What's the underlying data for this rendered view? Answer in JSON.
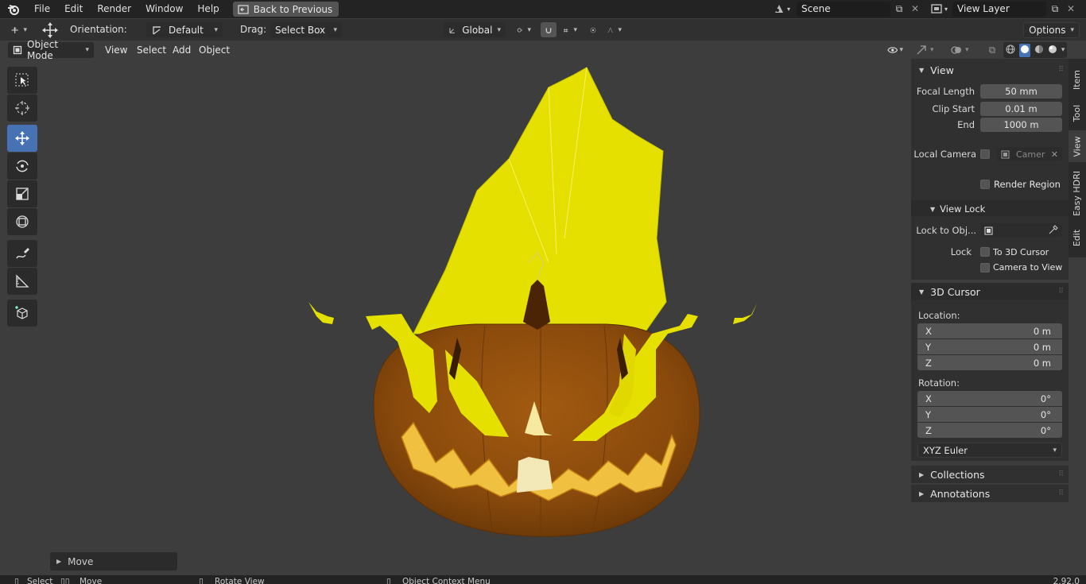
{
  "topbar": {
    "menus": [
      "File",
      "Edit",
      "Render",
      "Window",
      "Help"
    ],
    "back_button": "Back to Previous",
    "scene": "Scene",
    "view_layer": "View Layer"
  },
  "toolbar": {
    "orientation_label": "Orientation:",
    "orientation_value": "Default",
    "drag_label": "Drag:",
    "drag_value": "Select Box",
    "transform_orientation": "Global",
    "options": "Options"
  },
  "header": {
    "mode": "Object Mode",
    "menus": [
      "View",
      "Select",
      "Add",
      "Object"
    ]
  },
  "tools": [
    "select-box-icon",
    "cursor-icon",
    "move-icon",
    "rotate-icon",
    "scale-icon",
    "transform-icon",
    "annotate-icon",
    "measure-icon",
    "add-cube-icon"
  ],
  "operator_panel": {
    "label": "Move"
  },
  "npanel": {
    "view": {
      "title": "View",
      "focal_length_label": "Focal Length",
      "focal_length": "50 mm",
      "clip_start_label": "Clip Start",
      "clip_start": "0.01 m",
      "end_label": "End",
      "end": "1000 m",
      "local_camera_label": "Local Camera",
      "camera_placeholder": "Camer",
      "render_region": "Render Region"
    },
    "view_lock": {
      "title": "View Lock",
      "lock_to_obj_label": "Lock to Obj...",
      "lock_label": "Lock",
      "to_3d_cursor": "To 3D Cursor",
      "camera_to_view": "Camera to View"
    },
    "cursor": {
      "title": "3D Cursor",
      "location_label": "Location:",
      "location": [
        {
          "axis": "X",
          "value": "0 m"
        },
        {
          "axis": "Y",
          "value": "0 m"
        },
        {
          "axis": "Z",
          "value": "0 m"
        }
      ],
      "rotation_label": "Rotation:",
      "rotation": [
        {
          "axis": "X",
          "value": "0°"
        },
        {
          "axis": "Y",
          "value": "0°"
        },
        {
          "axis": "Z",
          "value": "0°"
        }
      ],
      "rotation_mode": "XYZ Euler"
    },
    "collections": "Collections",
    "annotations": "Annotations"
  },
  "side_tabs": [
    "Item",
    "Tool",
    "View",
    "Easy HDRI",
    "Edit"
  ],
  "statusbar": {
    "items": [
      "Select",
      "Move",
      "Rotate View",
      "Object Context Menu"
    ],
    "version": "2.92.0"
  },
  "colors": {
    "accent": "#4772b3",
    "flame": "#e6e000",
    "pumpkin": "#8a4d0c"
  }
}
